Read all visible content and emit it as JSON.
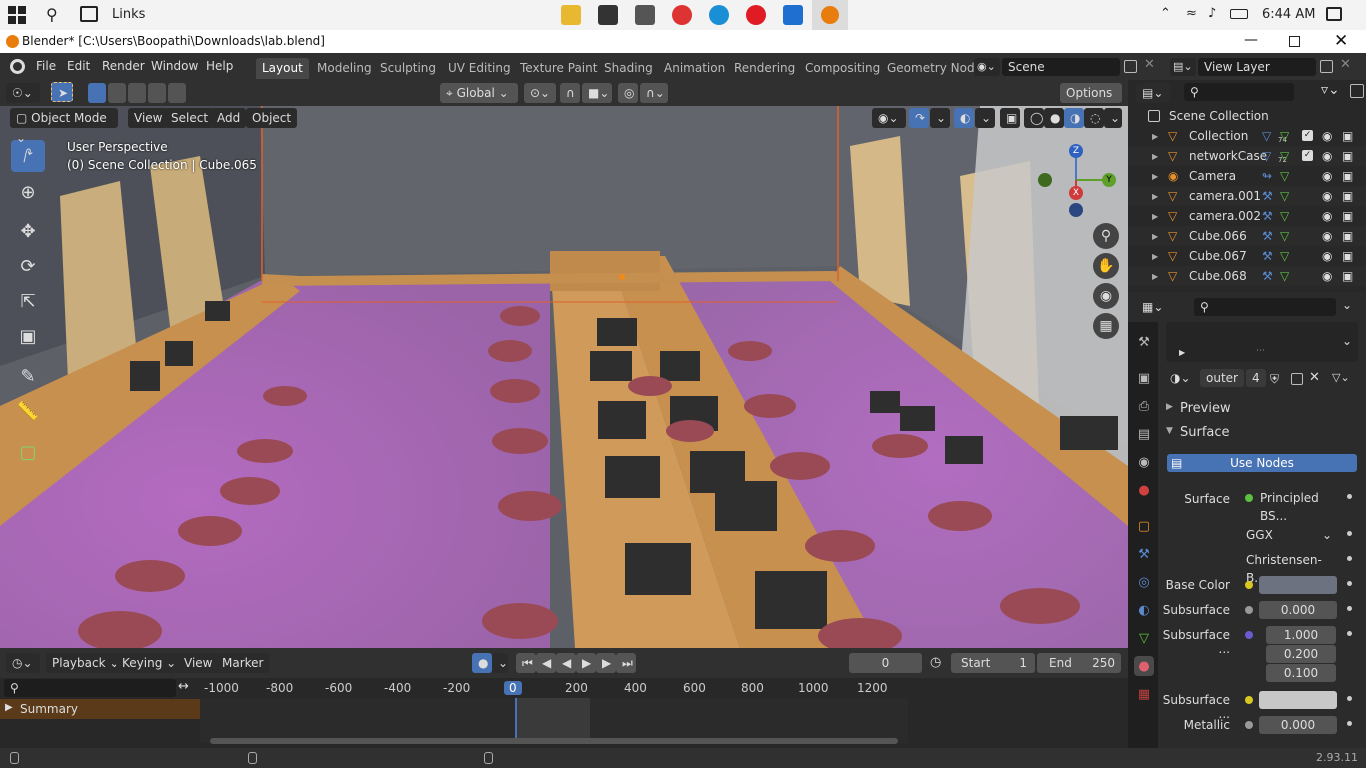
{
  "taskbar": {
    "app_name": "Links",
    "time": "6:44 AM"
  },
  "window": {
    "title": "Blender* [C:\\Users\\Boopathi\\Downloads\\lab.blend]"
  },
  "menu": {
    "file": "File",
    "edit": "Edit",
    "render": "Render",
    "window": "Window",
    "help": "Help"
  },
  "workspaces": [
    "Layout",
    "Modeling",
    "Sculpting",
    "UV Editing",
    "Texture Paint",
    "Shading",
    "Animation",
    "Rendering",
    "Compositing",
    "Geometry Nod"
  ],
  "scene": {
    "name": "Scene",
    "view_layer": "View Layer"
  },
  "viewport_header": {
    "transform": "Global",
    "options": "Options",
    "mode": "Object Mode",
    "view": "View",
    "select": "Select",
    "add": "Add",
    "object": "Object"
  },
  "viewport": {
    "perspective": "User Perspective",
    "collection": "(0) Scene Collection | Cube.065"
  },
  "gizmo": {
    "z": "Z",
    "y": "Y",
    "x": "X"
  },
  "outliner": {
    "root": "Scene Collection",
    "items": [
      {
        "name": "Collection",
        "badge": "74"
      },
      {
        "name": "networkCase",
        "badge": "72"
      },
      {
        "name": "Camera",
        "badge": ""
      },
      {
        "name": "camera.001",
        "badge": ""
      },
      {
        "name": "camera.002",
        "badge": ""
      },
      {
        "name": "Cube.066",
        "badge": ""
      },
      {
        "name": "Cube.067",
        "badge": ""
      },
      {
        "name": "Cube.068",
        "badge": ""
      }
    ]
  },
  "properties": {
    "material_name": "outer",
    "material_users": "4",
    "preview": "Preview",
    "surface_section": "Surface",
    "use_nodes": "Use Nodes",
    "surface_label": "Surface",
    "surface_value": "Principled BS...",
    "distribution": "GGX",
    "subsurface_method": "Christensen-B...",
    "base_color_label": "Base Color",
    "subsurface_label": "Subsurface",
    "subsurface_value": "0.000",
    "subsurface_radius_label": "Subsurface ...",
    "radius": [
      "1.000",
      "0.200",
      "0.100"
    ],
    "subsurface_color_label": "Subsurface ...",
    "metallic_label": "Metallic",
    "metallic_value": "0.000",
    "colors": {
      "base": "#6d7280",
      "subsurface_color": "#c8c8c8"
    }
  },
  "timeline": {
    "playback": "Playback",
    "keying": "Keying",
    "view": "View",
    "marker": "Marker",
    "current_frame": "0",
    "start_label": "Start",
    "start": "1",
    "end_label": "End",
    "end": "250",
    "ruler": [
      "-1000",
      "-800",
      "-600",
      "-400",
      "-200",
      "0",
      "200",
      "400",
      "600",
      "800",
      "1000",
      "1200"
    ],
    "summary": "Summary"
  },
  "status": {
    "version": "2.93.11"
  }
}
